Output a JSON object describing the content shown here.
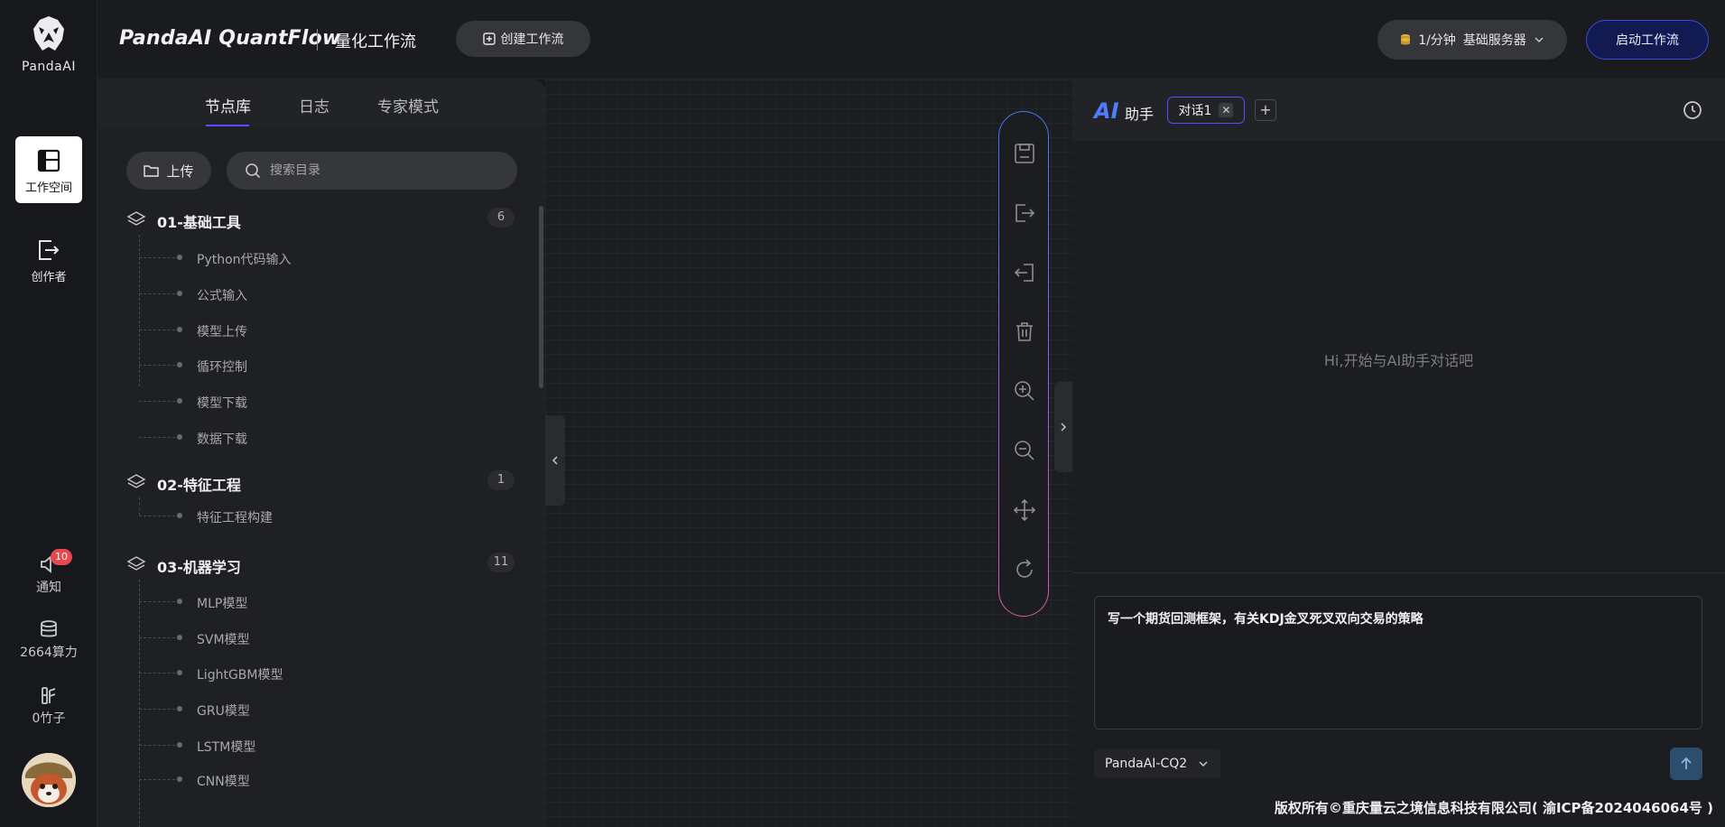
{
  "brand": {
    "logo_text": "PandaAI",
    "title": "PandaAI QuantFlow",
    "subtitle": "量化工作流"
  },
  "header": {
    "create_label": "创建工作流",
    "rate": "1/分钟",
    "server_label": "基础服务器",
    "start_label": "启动工作流"
  },
  "rail": {
    "workspace": "工作空间",
    "creator": "创作者",
    "notify": "通知",
    "notify_count": "10",
    "compute": "2664算力",
    "bamboo": "0竹子"
  },
  "node_panel": {
    "tabs": [
      "节点库",
      "日志",
      "专家模式"
    ],
    "upload_label": "上传",
    "search_placeholder": "搜索目录",
    "categories": [
      {
        "name": "01-基础工具",
        "count": "6",
        "items": [
          "Python代码输入",
          "公式输入",
          "模型上传",
          "循环控制",
          "模型下载",
          "数据下载"
        ]
      },
      {
        "name": "02-特征工程",
        "count": "1",
        "items": [
          "特征工程构建"
        ]
      },
      {
        "name": "03-机器学习",
        "count": "11",
        "items": [
          "MLP模型",
          "SVM模型",
          "LightGBM模型",
          "GRU模型",
          "LSTM模型",
          "CNN模型"
        ]
      }
    ]
  },
  "ai": {
    "logo": "AI",
    "title": "助手",
    "conversation_tab": "对话1",
    "empty_text": "Hi,开始与AI助手对话吧",
    "input_value": "写一个期货回测框架，有关KDJ金叉死叉双向交易的策略",
    "model": "PandaAI-CQ2"
  },
  "footer": {
    "copyright": "版权所有©重庆量云之境信息科技有限公司( 渝ICP备2024046064号 )"
  },
  "colors": {
    "accent": "#5b4cff",
    "start_button_bg": "#121a52",
    "badge": "#e5484d"
  }
}
